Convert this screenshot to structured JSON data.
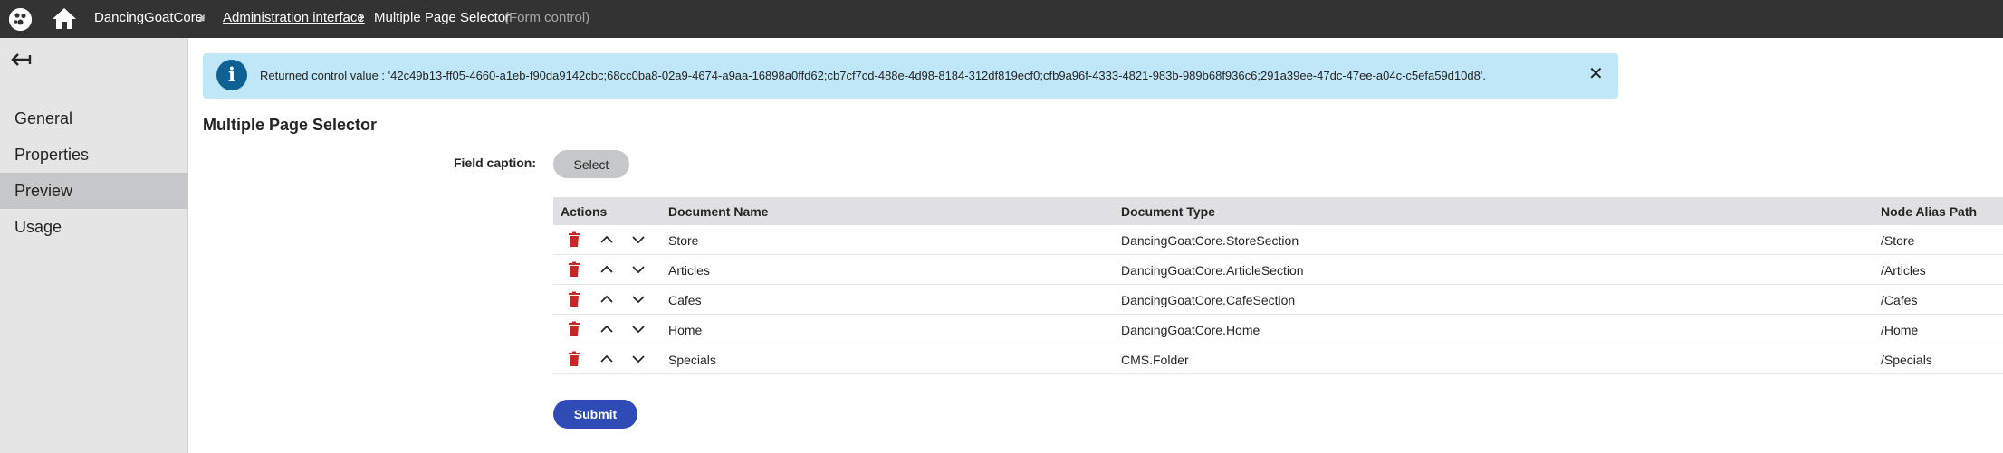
{
  "topbar": {
    "logo_icon": "kentico-logo-icon",
    "home_icon": "home-icon",
    "site_name": "DancingGoatCore",
    "site_caret": "◢",
    "breadcrumb_link": "Administration interface",
    "breadcrumb_separator": "›",
    "breadcrumb_current": "Multiple Page Selector",
    "breadcrumb_sub": "(Form control)"
  },
  "sidebar": {
    "back_icon": "back-arrow-icon",
    "items": [
      {
        "label": "General"
      },
      {
        "label": "Properties"
      },
      {
        "label": "Preview",
        "active": true
      },
      {
        "label": "Usage"
      }
    ]
  },
  "info": {
    "icon": "info-icon",
    "text": "Returned control value : '42c49b13-ff05-4660-a1eb-f90da9142cbc;68cc0ba8-02a9-4674-a9aa-16898a0ffd62;cb7cf7cd-488e-4d98-8184-312df819ecf0;cfb9a96f-4333-4821-983b-989b68f936c6;291a39ee-47dc-47ee-a04c-c5efa59d10d8'.",
    "close_icon": "close-icon"
  },
  "page": {
    "title": "Multiple Page Selector",
    "field_caption": "Field caption:",
    "select_label": "Select",
    "submit_label": "Submit"
  },
  "table": {
    "columns": [
      "Actions",
      "Document Name",
      "Document Type",
      "Node Alias Path"
    ],
    "rows": [
      {
        "name": "Store",
        "type": "DancingGoatCore.StoreSection",
        "path": "/Store"
      },
      {
        "name": "Articles",
        "type": "DancingGoatCore.ArticleSection",
        "path": "/Articles"
      },
      {
        "name": "Cafes",
        "type": "DancingGoatCore.CafeSection",
        "path": "/Cafes"
      },
      {
        "name": "Home",
        "type": "DancingGoatCore.Home",
        "path": "/Home"
      },
      {
        "name": "Specials",
        "type": "CMS.Folder",
        "path": "/Specials"
      }
    ],
    "action_icons": [
      "delete-icon",
      "move-up-icon",
      "move-down-icon"
    ]
  },
  "colors": {
    "topbar": "#333333",
    "sidebar": "#e5e5e5",
    "sidebar_active": "#c6c7c9",
    "info_bg": "#bfe7f8",
    "info_icon": "#0f6194",
    "delete_red": "#c62828",
    "submit_blue": "#2f4bb6"
  }
}
